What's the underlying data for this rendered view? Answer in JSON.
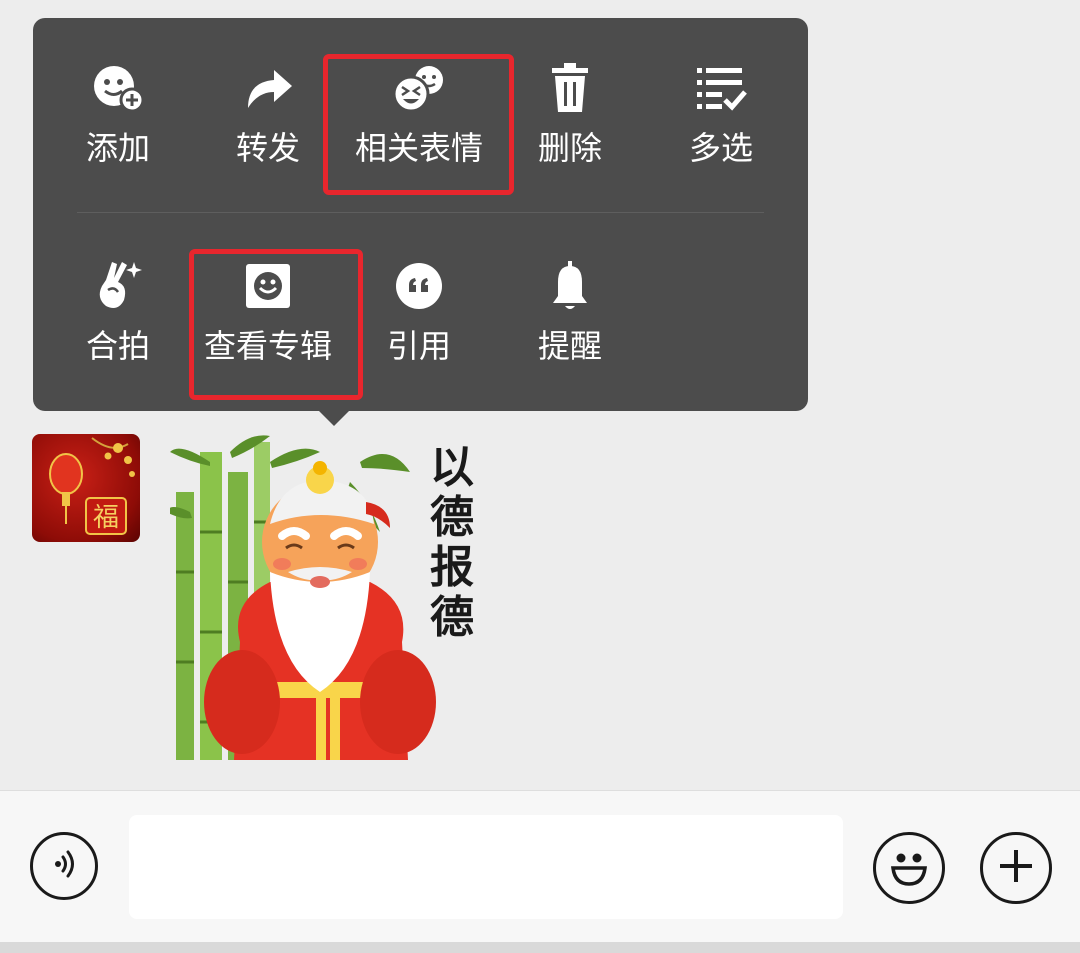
{
  "context_menu": {
    "row1": [
      {
        "label": "添加",
        "icon": "sticker-add-icon"
      },
      {
        "label": "转发",
        "icon": "forward-arrow-icon"
      },
      {
        "label": "相关表情",
        "icon": "related-stickers-icon"
      },
      {
        "label": "删除",
        "icon": "trash-icon"
      },
      {
        "label": "多选",
        "icon": "multi-select-icon"
      }
    ],
    "row2": [
      {
        "label": "合拍",
        "icon": "pair-photo-icon"
      },
      {
        "label": "查看专辑",
        "icon": "sticker-album-icon"
      },
      {
        "label": "引用",
        "icon": "quote-icon"
      },
      {
        "label": "提醒",
        "icon": "bell-icon"
      }
    ]
  },
  "highlights": [
    "相关表情",
    "查看专辑"
  ],
  "message": {
    "sticker_text": "以德报德",
    "sticker_chars": [
      "以",
      "德",
      "报",
      "德"
    ],
    "avatar_text": "福"
  },
  "input_bar": {
    "voice_icon": "voice-icon",
    "emoji_icon": "emoji-icon",
    "plus_icon": "plus-icon",
    "input_value": "",
    "input_placeholder": ""
  },
  "colors": {
    "menu_bg": "#4c4c4c",
    "highlight": "#e8262d",
    "chat_bg": "#ededed",
    "input_bar_bg": "#f7f7f7"
  }
}
